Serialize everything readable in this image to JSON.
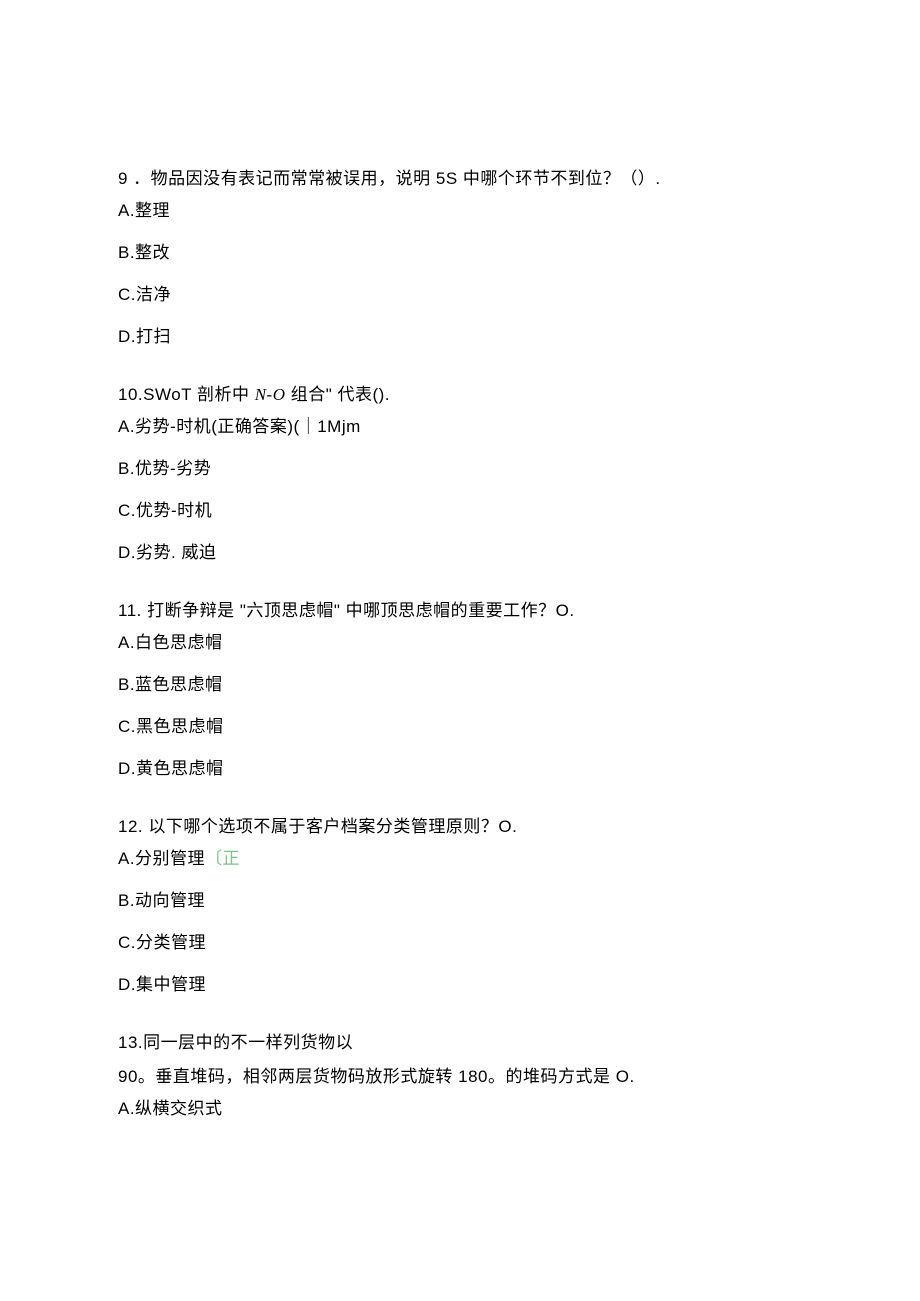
{
  "q9": {
    "stem": "9 ．物品因没有表记而常常被误用，说明 5S 中哪个环节不到位？（）.",
    "A": "A.整理",
    "B": "B.整改",
    "C": "C.洁净",
    "D": "D.打扫"
  },
  "q10": {
    "stem_prefix": "10.SWoT 剖析中 ",
    "stem_italic": "N-O",
    "stem_suffix": " 组合\" 代表().",
    "A": "A.劣势-时机(正确答案)(｜1Mjm",
    "B": "B.优势-劣势",
    "C": "C.优势-时机",
    "D": "D.劣势. 威迫"
  },
  "q11": {
    "stem": "11. 打断争辩是 \"六顶思虑帽\" 中哪顶思虑帽的重要工作？O.",
    "A": "A.白色思虑帽",
    "B": "B.蓝色思虑帽",
    "C": "C.黑色思虑帽",
    "D": "D.黄色思虑帽"
  },
  "q12": {
    "stem": "12. 以下哪个选项不属于客户档案分类管理原则？O.",
    "A_prefix": "A.分别管理",
    "A_highlight": "〔正",
    "B": "B.动向管理",
    "C": "C.分类管理",
    "D": "D.集中管理"
  },
  "q13": {
    "stem": "13.同一层中的不一样列货物以",
    "line2": "90。垂直堆码，相邻两层货物码放形式旋转 180。的堆码方式是 O.",
    "A": "A.纵横交织式"
  }
}
